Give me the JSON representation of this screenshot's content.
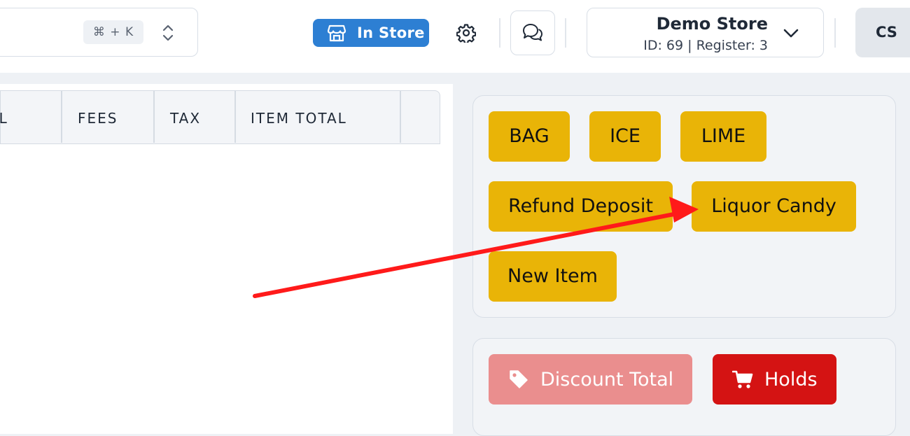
{
  "topbar": {
    "search": {
      "shortcut": "⌘ + K"
    },
    "mode_badge": {
      "label": "In Store",
      "icon": "store-icon",
      "color": "#2d7fd3"
    },
    "settings": {
      "icon": "gear-icon"
    },
    "chat": {
      "icon": "chat-bubbles-icon"
    },
    "store_selector": {
      "name": "Demo Store",
      "meta": "ID: 69 | Register: 3",
      "icon": "chevron-down-icon"
    },
    "user": {
      "initials": "CS"
    }
  },
  "cart_table": {
    "columns": [
      "AL",
      "FEES",
      "TAX",
      "ITEM TOTAL",
      ""
    ],
    "rows": []
  },
  "quick_items": {
    "color": "#e9b407",
    "items": [
      {
        "label": "BAG"
      },
      {
        "label": "ICE"
      },
      {
        "label": "LIME"
      },
      {
        "label": "Refund Deposit"
      },
      {
        "label": "Liquor Candy"
      },
      {
        "label": "New Item"
      }
    ]
  },
  "actions": {
    "discount": {
      "label": "Discount Total",
      "icon": "tag-icon",
      "color": "#ea8e8e"
    },
    "holds": {
      "label": "Holds",
      "icon": "cart-icon",
      "color": "#d41313"
    }
  },
  "annotation": {
    "type": "arrow",
    "color": "#ff1a1a",
    "target": "Liquor Candy"
  }
}
